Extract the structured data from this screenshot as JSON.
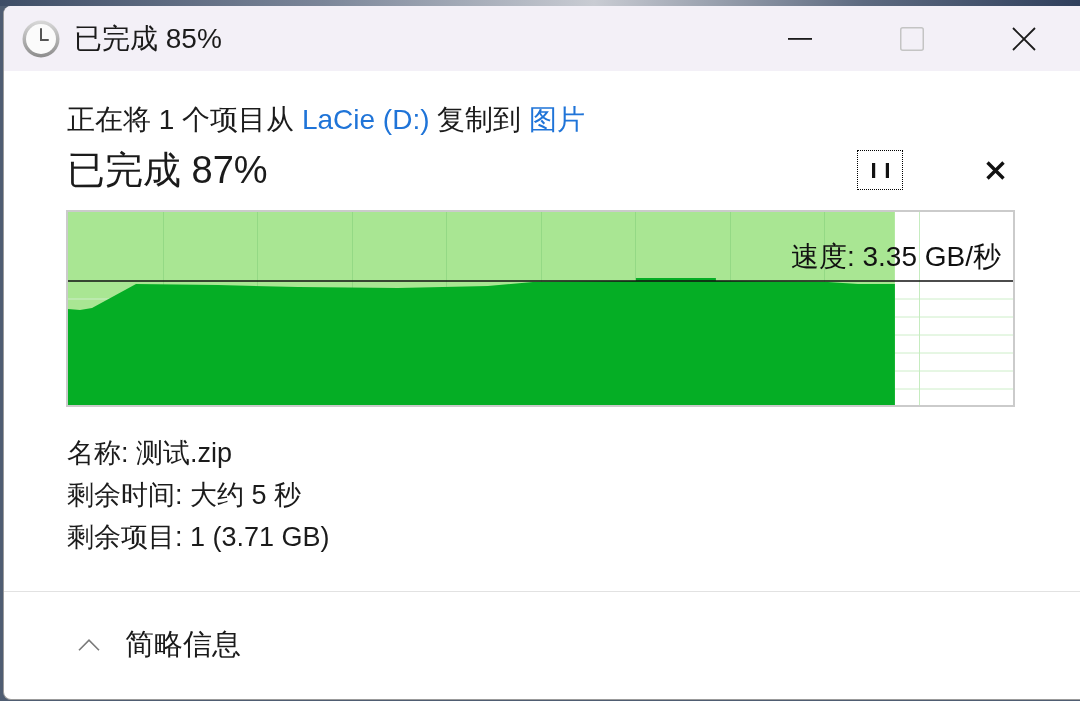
{
  "window": {
    "title": "已完成 85%",
    "controls": [
      {
        "kind": "minimize",
        "disabled": false
      },
      {
        "kind": "maximize",
        "disabled": true
      },
      {
        "kind": "close",
        "disabled": false
      }
    ]
  },
  "description": [
    {
      "kind": "text",
      "text": "正在将 1 个项目从"
    },
    {
      "kind": "link",
      "text": "LaCie (D:)"
    },
    {
      "kind": "text",
      "text": "复制到"
    },
    {
      "kind": "link",
      "text": "图片"
    }
  ],
  "status": {
    "title": "已完成 87%",
    "pause_button": {
      "focused": true
    }
  },
  "graph": {
    "level": 0.875,
    "speed": "速度: 3.35 GB/秒"
  },
  "details": [
    "名称: 测试.zip",
    "剩余时间: 大约 5 秒",
    "剩余项目: 1 (3.71 GB)"
  ],
  "footer": {
    "toggle": {
      "label": "简略信息",
      "expanded": true
    }
  }
}
